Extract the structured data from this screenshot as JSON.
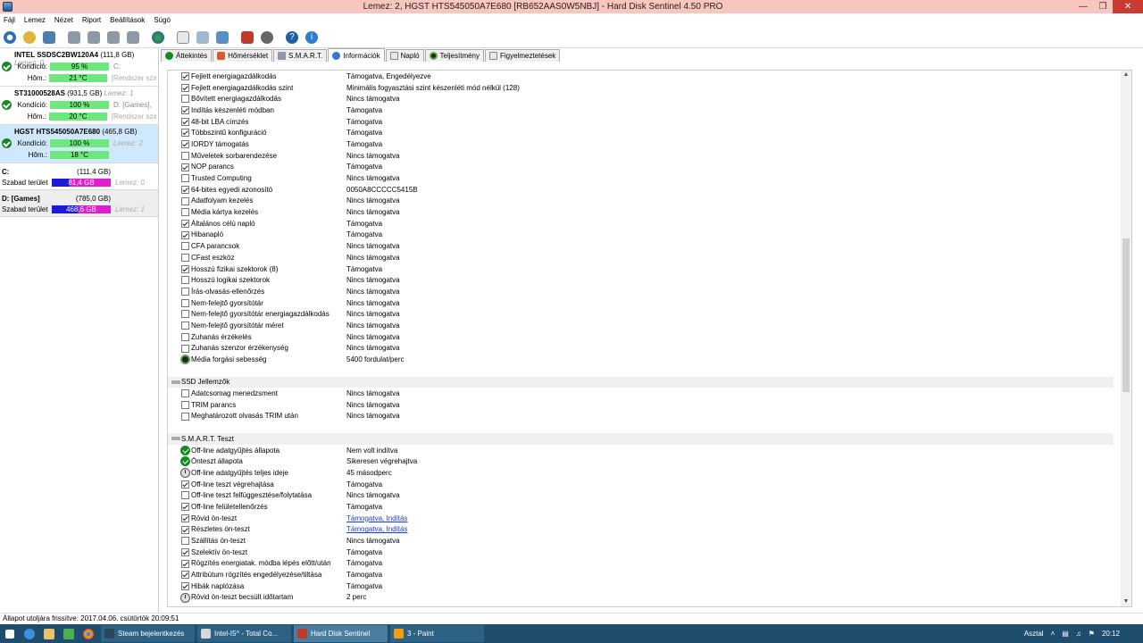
{
  "window": {
    "title": "Lemez: 2, HGST HTS545050A7E680 [RB652AAS0W5NBJ]  -  Hard Disk Sentinel 4.50 PRO"
  },
  "menu": [
    "Fájl",
    "Lemez",
    "Nézet",
    "Riport",
    "Beállítások",
    "Súgó"
  ],
  "tabs": [
    "Áttekintés",
    "Hőmérséklet",
    "S.M.A.R.T.",
    "Információk",
    "Napló",
    "Teljesítmény",
    "Figyelmeztetések"
  ],
  "disks": [
    {
      "name": "INTEL SSDSC2BW120A4",
      "size": "(111,8 GB)",
      "hint": "Lemez: 0",
      "condition": "95 %",
      "temp": "21 °C",
      "extra1": "C:",
      "extra2": "[Rendszer sza"
    },
    {
      "name": "ST31000528AS",
      "size": "(931,5 GB)",
      "hint": "Lemez: 1",
      "condition": "100 %",
      "temp": "20 °C",
      "extra1": "D: [Games],",
      "extra2": "[Rendszer sza"
    },
    {
      "name": "HGST HTS545050A7E680",
      "size": "(465,8 GB)",
      "hint": "",
      "condition": "100 %",
      "temp": "18 °C",
      "extra1": "Lemez: 2",
      "extra2": ""
    }
  ],
  "disk_labels": {
    "condition": "Kondíció:",
    "temp": "Hőm.:"
  },
  "volumes": [
    {
      "name": "C:",
      "size": "(111,4 GB)",
      "free_label": "Szabad terület",
      "free": "81,4 GB",
      "disk": "Lemez: 0"
    },
    {
      "name": "D: [Games]",
      "size": "(785,0 GB)",
      "free_label": "Szabad terület",
      "free": "468,6 GB",
      "disk": "Lemez: 1"
    }
  ],
  "features": [
    {
      "k": "Fejlett energiagazdálkodás",
      "v": "Támogatva, Engedélyezve",
      "i": "on"
    },
    {
      "k": "Fejlett energiagazdálkodás szint",
      "v": "Minimális fogyasztási szint készenléti mód nélkül (128)",
      "i": "on"
    },
    {
      "k": "Bővített energiagazdálkodás",
      "v": "Nincs támogatva",
      "i": "off"
    },
    {
      "k": "Indítás készenléti módban",
      "v": "Támogatva",
      "i": "on"
    },
    {
      "k": "48-bit LBA címzés",
      "v": "Támogatva",
      "i": "on"
    },
    {
      "k": "Többszintű konfiguráció",
      "v": "Támogatva",
      "i": "on"
    },
    {
      "k": "IORDY támogatás",
      "v": "Támogatva",
      "i": "on"
    },
    {
      "k": "Műveletek sorbarendezése",
      "v": "Nincs támogatva",
      "i": "off"
    },
    {
      "k": "NOP parancs",
      "v": "Támogatva",
      "i": "on"
    },
    {
      "k": "Trusted Computing",
      "v": "Nincs támogatva",
      "i": "off"
    },
    {
      "k": "64-bites egyedi azonosító",
      "v": "0050A8CCCCC5415B",
      "i": "on"
    },
    {
      "k": "Adatfolyam kezelés",
      "v": "Nincs támogatva",
      "i": "off"
    },
    {
      "k": "Média kártya kezelés",
      "v": "Nincs támogatva",
      "i": "off"
    },
    {
      "k": "Általános célú napló",
      "v": "Támogatva",
      "i": "on"
    },
    {
      "k": "Hibanapló",
      "v": "Támogatva",
      "i": "on"
    },
    {
      "k": "CFA parancsok",
      "v": "Nincs támogatva",
      "i": "off"
    },
    {
      "k": "CFast eszköz",
      "v": "Nincs támogatva",
      "i": "off"
    },
    {
      "k": "Hosszú fizikai szektorok (8)",
      "v": "Támogatva",
      "i": "on"
    },
    {
      "k": "Hosszú logikai szektorok",
      "v": "Nincs támogatva",
      "i": "off"
    },
    {
      "k": "Írás-olvasás-ellenőrzés",
      "v": "Nincs támogatva",
      "i": "off"
    },
    {
      "k": "Nem-felejtő gyorsítótár",
      "v": "Nincs támogatva",
      "i": "off"
    },
    {
      "k": "Nem-felejtő gyorsítótár energiagazdálkodás",
      "v": "Nincs támogatva",
      "i": "off"
    },
    {
      "k": "Nem-felejtő gyorsítótár méret",
      "v": "Nincs támogatva",
      "i": "off"
    },
    {
      "k": "Zuhanás érzékelés",
      "v": "Nincs támogatva",
      "i": "off"
    },
    {
      "k": "Zuhanás szenzor érzékenység",
      "v": "Nincs támogatva",
      "i": "off"
    },
    {
      "k": "Média forgási sebesség",
      "v": "5400 fordulat/perc",
      "i": "gear"
    }
  ],
  "ssd": {
    "title": "SSD Jellemzők",
    "rows": [
      {
        "k": "Adatcsomag menedzsment",
        "v": "Nincs támogatva",
        "i": "off"
      },
      {
        "k": "TRIM parancs",
        "v": "Nincs támogatva",
        "i": "off"
      },
      {
        "k": "Meghatározott olvasás TRIM után",
        "v": "Nincs támogatva",
        "i": "off"
      }
    ]
  },
  "smart": {
    "title": "S.M.A.R.T. Teszt",
    "rows": [
      {
        "k": "Off-line adatgyűjtés állapota",
        "v": "Nem volt indítva",
        "i": "ok"
      },
      {
        "k": "Önteszt állapota",
        "v": "Sikeresen végrehajtva",
        "i": "ok"
      },
      {
        "k": "Off-line adatgyűjtés teljes ideje",
        "v": "45 másodperc",
        "i": "clock"
      },
      {
        "k": "Off-line teszt végrehajtása",
        "v": "Támogatva",
        "i": "on"
      },
      {
        "k": "Off-line teszt felfüggesztése/folytatása",
        "v": "Nincs támogatva",
        "i": "off"
      },
      {
        "k": "Off-line felületellenőrzés",
        "v": "Támogatva",
        "i": "on"
      },
      {
        "k": "Rövid ön-teszt",
        "v": "Támogatva, Indítás",
        "i": "on",
        "link": true
      },
      {
        "k": "Részletes ön-teszt",
        "v": "Támogatva, Indítás",
        "i": "on",
        "link": true
      },
      {
        "k": "Szállítás ön-teszt",
        "v": "Nincs támogatva",
        "i": "off"
      },
      {
        "k": "Szelektív ön-teszt",
        "v": "Támogatva",
        "i": "on"
      },
      {
        "k": "Rögzítés energiatak. módba lépés előtt/után",
        "v": "Támogatva",
        "i": "on"
      },
      {
        "k": "Attribútum rögzítés engedélyezése/tiltása",
        "v": "Támogatva",
        "i": "on"
      },
      {
        "k": "Hibák naplózása",
        "v": "Támogatva",
        "i": "on"
      },
      {
        "k": "Rövid ön-teszt becsült időtartam",
        "v": "2 perc",
        "i": "clock"
      }
    ]
  },
  "status": "Állapot utoljára frissítve: 2017.04.06. csütörtök 20:09:51",
  "taskbar": {
    "items": [
      "Steam bejelentkezés",
      "Intel-I5^ - Total Co...",
      "Hard Disk Sentinel",
      "3 - Paint"
    ],
    "desktop": "Asztal",
    "time": "20:12"
  }
}
